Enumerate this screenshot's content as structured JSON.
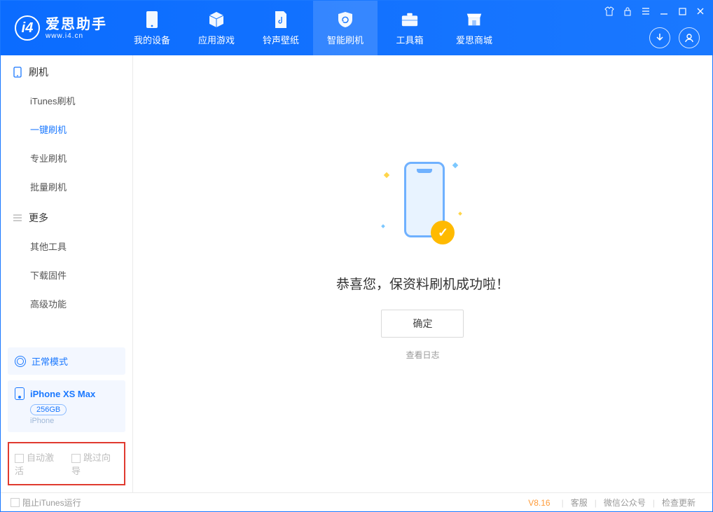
{
  "app": {
    "title": "爱思助手",
    "url": "www.i4.cn"
  },
  "nav": {
    "items": [
      {
        "label": "我的设备"
      },
      {
        "label": "应用游戏"
      },
      {
        "label": "铃声壁纸"
      },
      {
        "label": "智能刷机"
      },
      {
        "label": "工具箱"
      },
      {
        "label": "爱思商城"
      }
    ],
    "active_index": 3
  },
  "sidebar": {
    "group1_title": "刷机",
    "group1_items": [
      {
        "label": "iTunes刷机"
      },
      {
        "label": "一键刷机"
      },
      {
        "label": "专业刷机"
      },
      {
        "label": "批量刷机"
      }
    ],
    "group1_active_index": 1,
    "group2_title": "更多",
    "group2_items": [
      {
        "label": "其他工具"
      },
      {
        "label": "下载固件"
      },
      {
        "label": "高级功能"
      }
    ],
    "mode_label": "正常模式",
    "device": {
      "name": "iPhone XS Max",
      "capacity": "256GB",
      "type": "iPhone"
    },
    "options": {
      "auto_activate": "自动激活",
      "skip_guide": "跳过向导"
    }
  },
  "main": {
    "success_title": "恭喜您，保资料刷机成功啦！",
    "ok_button": "确定",
    "view_log": "查看日志"
  },
  "footer": {
    "block_itunes": "阻止iTunes运行",
    "version": "V8.16",
    "links": {
      "kefu": "客服",
      "wechat": "微信公众号",
      "check_update": "检查更新"
    }
  }
}
